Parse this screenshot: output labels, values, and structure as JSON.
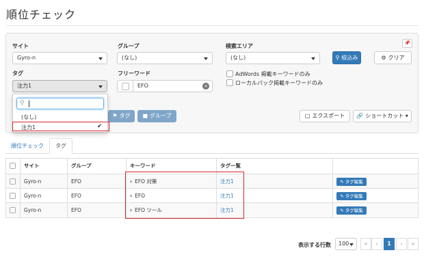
{
  "page": {
    "title": "順位チェック"
  },
  "filters": {
    "site": {
      "label": "サイト",
      "value": "Gyro-n"
    },
    "group": {
      "label": "グループ",
      "value": "(なし)"
    },
    "area": {
      "label": "検索エリア",
      "value": "(なし)"
    },
    "tag": {
      "label": "タグ",
      "value": "注力1"
    },
    "freeword": {
      "label": "フリーワード",
      "value": "EFO"
    },
    "checks": [
      {
        "label": "AdWords 掲載キーワードのみ",
        "checked": false
      },
      {
        "label": "ローカルパック掲載キーワードのみ",
        "checked": false
      }
    ],
    "search_button": "絞込み",
    "clear_button": "クリア",
    "pin_icon": "pin-icon"
  },
  "tag_dropdown": {
    "search_value": "",
    "options": [
      {
        "label": "(なし)",
        "selected": false
      },
      {
        "label": "注力1",
        "selected": true
      }
    ]
  },
  "actions": {
    "tag_button": "タグ",
    "group_button": "グループ",
    "export_button": "エクスポート",
    "shortcut_button": "ショートカット"
  },
  "tabs": [
    {
      "label": "順位チェック",
      "active": false
    },
    {
      "label": "タグ",
      "active": true
    }
  ],
  "table": {
    "columns": [
      "サイト",
      "グループ",
      "キーワード",
      "タグ一覧"
    ],
    "rows": [
      {
        "site": "Gyro-n",
        "group": "EFO",
        "keyword": "EFO 対策",
        "tags": "注力1",
        "action": "タグ編集"
      },
      {
        "site": "Gyro-n",
        "group": "EFO",
        "keyword": "EFO",
        "tags": "注力1",
        "action": "タグ編集"
      },
      {
        "site": "Gyro-n",
        "group": "EFO",
        "keyword": "EFO ツール",
        "tags": "注力1",
        "action": "タグ編集"
      }
    ]
  },
  "pagination": {
    "per_page_label": "表示する行数",
    "per_page_value": "100",
    "first": "«",
    "prev": "‹",
    "current": "1",
    "next": "›",
    "last": "»"
  },
  "colors": {
    "primary": "#337ab7",
    "highlight": "#d62728",
    "info": "#7fa6c9"
  }
}
